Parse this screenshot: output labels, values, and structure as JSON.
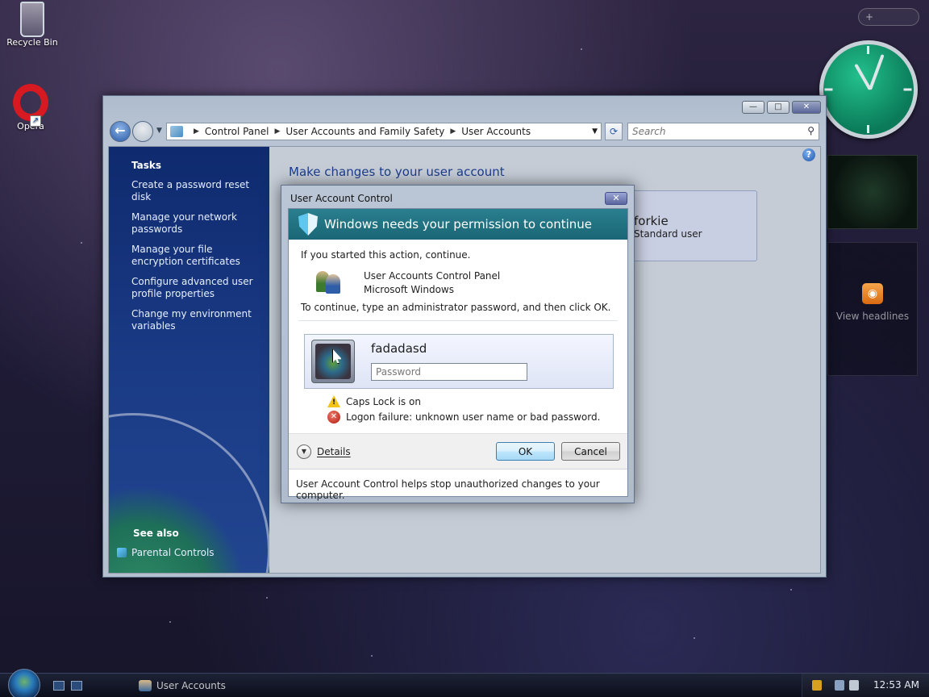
{
  "desktop": {
    "icons": [
      {
        "label": "Recycle Bin"
      },
      {
        "label": "Opera"
      }
    ]
  },
  "sidebar": {
    "feeds_label": "View headlines"
  },
  "window": {
    "breadcrumb": [
      "Control Panel",
      "User Accounts and Family Safety",
      "User Accounts"
    ],
    "search_placeholder": "Search",
    "tasks": {
      "heading": "Tasks",
      "items": [
        "Create a password reset disk",
        "Manage your network passwords",
        "Manage your file encryption certificates",
        "Configure advanced user profile properties",
        "Change my environment variables"
      ]
    },
    "see_also": {
      "heading": "See also",
      "items": [
        "Parental Controls"
      ]
    },
    "main": {
      "heading": "Make changes to your user account",
      "user_name": "forkie",
      "user_type": "Standard user"
    }
  },
  "uac": {
    "title": "User Account Control",
    "banner": "Windows needs your permission to continue",
    "started_text": "If you started this action, continue.",
    "program_name": "User Accounts Control Panel",
    "publisher": "Microsoft Windows",
    "instruction": "To continue, type an administrator password, and then click OK.",
    "account_name": "fadadasd",
    "password_placeholder": "Password",
    "warnings": [
      "Caps Lock is on",
      "Logon failure: unknown user name or bad password."
    ],
    "details_label": "Details",
    "ok_label": "OK",
    "cancel_label": "Cancel",
    "help_text": "User Account Control helps stop unauthorized changes to your computer."
  },
  "taskbar": {
    "task_label": "User Accounts",
    "clock": "12:53 AM"
  },
  "colors": {
    "uac_banner": "#1a6676",
    "task_pane": "#1a3a85",
    "link_blue": "#1c3d8c"
  }
}
